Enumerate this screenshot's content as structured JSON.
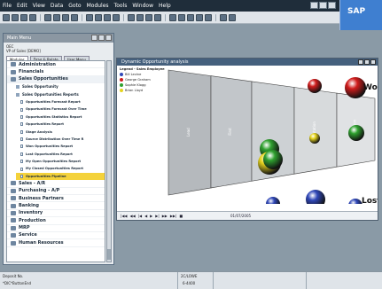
{
  "menu": {
    "items": [
      "File",
      "Edit",
      "View",
      "Data",
      "Goto",
      "Modules",
      "Tools",
      "Window",
      "Help"
    ]
  },
  "brand": {
    "logo_text": "SAP"
  },
  "main_menu": {
    "title": "Main Menu",
    "company": "OEC",
    "company_sub": "VP of Sales [DEMO]",
    "tabs": [
      "Modules",
      "Drag & Relate",
      "User Menu"
    ],
    "modules_top": [
      "Administration",
      "Financials",
      "Sales Opportunities"
    ],
    "sub_1": "Sales Opportunity",
    "sub_2": "Sales Opportunities Reports",
    "reports": [
      "Opportunities Forecast Report",
      "Opportunities Forecast Over Time",
      "Opportunities Statistics Report",
      "Opportunities Report",
      "Stage Analysis",
      "Source Distribution Over Time R",
      "Won Opportunities Report",
      "Lost Opportunities Report",
      "My Open Opportunities Report",
      "My Closed Opportunities Report",
      "Opportunities Pipeline"
    ],
    "modules_bottom": [
      "Sales - A/R",
      "Purchasing - A/P",
      "Business Partners",
      "Banking",
      "Inventory",
      "Production",
      "MRP",
      "Service",
      "Human Resources"
    ]
  },
  "analysis": {
    "title": "Dynamic Opportunity analysis",
    "legend_title": "Legend - Sales Employee",
    "legend": [
      {
        "name": "Bill Levine",
        "color": "#2f47b8"
      },
      {
        "name": "George Graham",
        "color": "#d01c1c"
      },
      {
        "name": "Sophie Klogg",
        "color": "#2fa12f"
      },
      {
        "name": "Brian Lloyd",
        "color": "#e6d41e"
      }
    ],
    "stages": [
      "Lead",
      "First",
      "",
      "Quotation",
      "Negotiation"
    ],
    "won_label": "Won",
    "lost_label": "Lost",
    "date": "01/07/2005"
  },
  "status": {
    "line1": "Deposit No.",
    "line2": "*DIC*ButtonEnd",
    "center1": "2C/LOWE",
    "center2": "6-4400"
  }
}
